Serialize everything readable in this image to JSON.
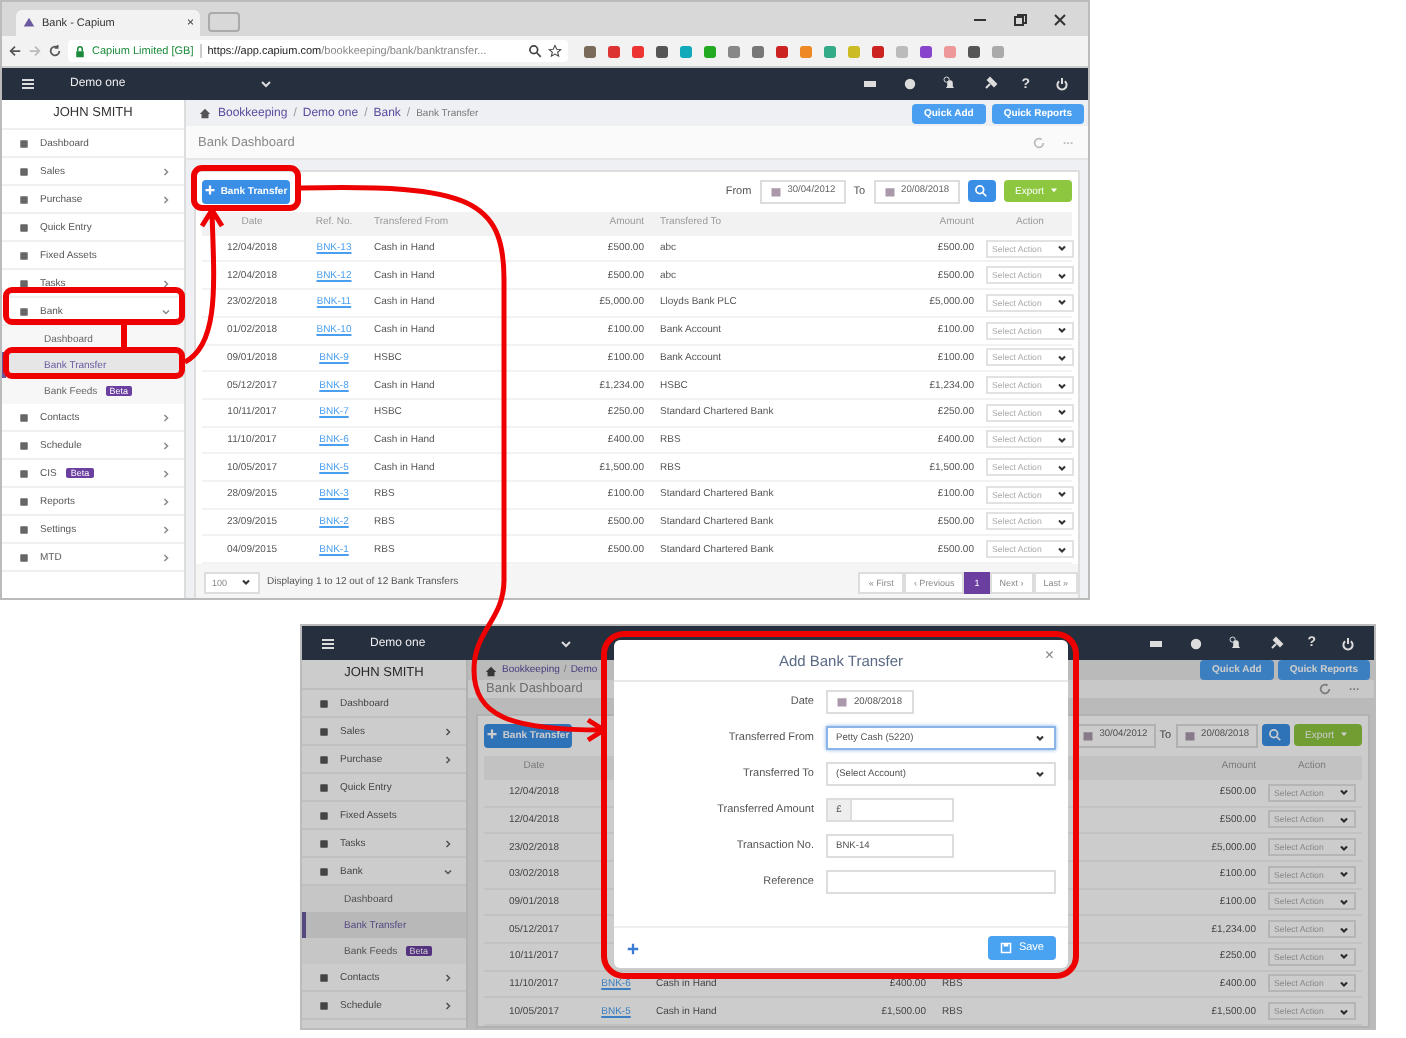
{
  "browser": {
    "tab_title": "Bank - Capium",
    "tab_close": "×",
    "site_name": "Capium Limited [GB]",
    "url_host": "https://app.capium.com",
    "url_path": "/bookkeeping/bank/banktransfer..."
  },
  "top": {
    "company": "Demo one",
    "help": "?",
    "user": "JOHN SMITH",
    "sidebar": [
      {
        "label": "Dashboard",
        "submenu": false
      },
      {
        "label": "Sales",
        "submenu": true,
        "expanded": false
      },
      {
        "label": "Purchase",
        "submenu": true,
        "expanded": false
      },
      {
        "label": "Quick Entry",
        "submenu": false
      },
      {
        "label": "Fixed Assets",
        "submenu": false
      },
      {
        "label": "Tasks",
        "submenu": true,
        "expanded": false
      },
      {
        "label": "Bank",
        "submenu": true,
        "expanded": true,
        "children": [
          {
            "label": "Dashboard",
            "selected": false
          },
          {
            "label": "Bank Transfer",
            "selected": true
          },
          {
            "label": "Bank Feeds",
            "selected": false,
            "badge": "Beta"
          }
        ]
      },
      {
        "label": "Contacts",
        "submenu": true,
        "expanded": false
      },
      {
        "label": "Schedule",
        "submenu": true,
        "expanded": false
      },
      {
        "label": "CIS",
        "submenu": true,
        "expanded": false,
        "badge": "Beta"
      },
      {
        "label": "Reports",
        "submenu": true,
        "expanded": false
      },
      {
        "label": "Settings",
        "submenu": true,
        "expanded": false
      },
      {
        "label": "MTD",
        "submenu": true,
        "expanded": false
      }
    ],
    "breadcrumb": [
      {
        "label": "Bookkeeping"
      },
      {
        "sep": "/",
        "label": "Demo one"
      },
      {
        "sep": "/",
        "label": "Bank"
      },
      {
        "sep": "/",
        "label": "Bank Transfer"
      }
    ],
    "quick_add": "Quick Add",
    "quick_reports": "Quick Reports",
    "page_title": "Bank Dashboard",
    "add_button": "Bank Transfer",
    "from_label": "From",
    "from_date": "30/04/2012",
    "to_label": "To",
    "to_date": "20/08/2018",
    "export": "Export",
    "columns": [
      "Date",
      "Ref. No.",
      "Transfered From",
      "Amount",
      "Transfered To",
      "Amount",
      "Action"
    ],
    "rows": [
      {
        "date": "12/04/2018",
        "ref": "BNK-13",
        "from": "Cash in Hand",
        "amount": "£500.00",
        "to": "abc",
        "amount_to": "£500.00",
        "action": "Select Action"
      },
      {
        "date": "12/04/2018",
        "ref": "BNK-12",
        "from": "Cash in Hand",
        "amount": "£500.00",
        "to": "abc",
        "amount_to": "£500.00",
        "action": "Select Action"
      },
      {
        "date": "23/02/2018",
        "ref": "BNK-11",
        "from": "Cash in Hand",
        "amount": "£5,000.00",
        "to": "Lloyds Bank PLC",
        "amount_to": "£5,000.00",
        "action": "Select Action"
      },
      {
        "date": "01/02/2018",
        "ref": "BNK-10",
        "from": "Cash in Hand",
        "amount": "£100.00",
        "to": "Bank Account",
        "amount_to": "£100.00",
        "action": "Select Action"
      },
      {
        "date": "09/01/2018",
        "ref": "BNK-9",
        "from": "HSBC",
        "amount": "£100.00",
        "to": "Bank Account",
        "amount_to": "£100.00",
        "action": "Select Action"
      },
      {
        "date": "05/12/2017",
        "ref": "BNK-8",
        "from": "Cash in Hand",
        "amount": "£1,234.00",
        "to": "HSBC",
        "amount_to": "£1,234.00",
        "action": "Select Action"
      },
      {
        "date": "10/11/2017",
        "ref": "BNK-7",
        "from": "HSBC",
        "amount": "£250.00",
        "to": "Standard Chartered Bank",
        "amount_to": "£250.00",
        "action": "Select Action"
      },
      {
        "date": "11/10/2017",
        "ref": "BNK-6",
        "from": "Cash in Hand",
        "amount": "£400.00",
        "to": "RBS",
        "amount_to": "£400.00",
        "action": "Select Action"
      },
      {
        "date": "10/05/2017",
        "ref": "BNK-5",
        "from": "Cash in Hand",
        "amount": "£1,500.00",
        "to": "RBS",
        "amount_to": "£1,500.00",
        "action": "Select Action"
      },
      {
        "date": "28/09/2015",
        "ref": "BNK-3",
        "from": "RBS",
        "amount": "£100.00",
        "to": "Standard Chartered Bank",
        "amount_to": "£100.00",
        "action": "Select Action"
      },
      {
        "date": "23/09/2015",
        "ref": "BNK-2",
        "from": "RBS",
        "amount": "£500.00",
        "to": "Standard Chartered Bank",
        "amount_to": "£500.00",
        "action": "Select Action"
      },
      {
        "date": "04/09/2015",
        "ref": "BNK-1",
        "from": "RBS",
        "amount": "£500.00",
        "to": "Standard Chartered Bank",
        "amount_to": "£500.00",
        "action": "Select Action"
      }
    ],
    "page_size": "100",
    "summary": "Displaying 1 to 12 out of 12 Bank Transfers",
    "pages": [
      {
        "label": "« First",
        "selected": false
      },
      {
        "label": "‹ Previous",
        "selected": false
      },
      {
        "label": "1",
        "selected": true
      },
      {
        "label": "Next ›",
        "selected": false
      },
      {
        "label": "Last »",
        "selected": false
      }
    ]
  },
  "bottom": {
    "company": "Demo one",
    "help": "?",
    "user": "JOHN SMITH",
    "sidebar": [
      {
        "label": "Dashboard",
        "submenu": false
      },
      {
        "label": "Sales",
        "submenu": true,
        "expanded": false
      },
      {
        "label": "Purchase",
        "submenu": true,
        "expanded": false
      },
      {
        "label": "Quick Entry",
        "submenu": false
      },
      {
        "label": "Fixed Assets",
        "submenu": false
      },
      {
        "label": "Tasks",
        "submenu": true,
        "expanded": false
      },
      {
        "label": "Bank",
        "submenu": true,
        "expanded": true,
        "children": [
          {
            "label": "Dashboard",
            "selected": false
          },
          {
            "label": "Bank Transfer",
            "selected": true
          },
          {
            "label": "Bank Feeds",
            "selected": false,
            "badge": "Beta"
          }
        ]
      },
      {
        "label": "Contacts",
        "submenu": true,
        "expanded": false
      },
      {
        "label": "Schedule",
        "submenu": true,
        "expanded": false
      }
    ],
    "breadcrumb": [
      {
        "label": "Bookkeeping"
      },
      {
        "sep": "/",
        "label": "Demo"
      }
    ],
    "quick_add": "Quick Add",
    "quick_reports": "Quick Reports",
    "page_title": "Bank Dashboard",
    "add_button": "Bank Transfer",
    "from_date": "30/04/2012",
    "to_label": "To",
    "to_date": "20/08/2018",
    "export": "Export",
    "header": {
      "date": "Date",
      "amount_to": "Amount",
      "action": "Action"
    },
    "rows": [
      {
        "date": "12/04/2018",
        "amount_to": "£500.00",
        "action": "Select Action"
      },
      {
        "date": "12/04/2018",
        "amount_to": "£500.00",
        "action": "Select Action"
      },
      {
        "date": "23/02/2018",
        "amount_to": "£5,000.00",
        "action": "Select Action"
      },
      {
        "date": "03/02/2018",
        "amount_to": "£100.00",
        "action": "Select Action"
      },
      {
        "date": "09/01/2018",
        "amount_to": "£100.00",
        "action": "Select Action"
      },
      {
        "date": "05/12/2017",
        "amount_to": "£1,234.00",
        "action": "Select Action"
      },
      {
        "date": "10/11/2017",
        "amount_to": "£250.00",
        "action": "Select Action"
      },
      {
        "date": "11/10/2017",
        "ref": "BNK-6",
        "from": "Cash in Hand",
        "amount": "£400.00",
        "to": "RBS",
        "amount_to": "£400.00",
        "action": "Select Action"
      },
      {
        "date": "10/05/2017",
        "ref": "BNK-5",
        "from": "Cash in Hand",
        "amount": "£1,500.00",
        "to": "RBS",
        "amount_to": "£1,500.00",
        "action": "Select Action"
      }
    ],
    "dialog": {
      "title": "Add Bank Transfer",
      "close": "×",
      "save": "Save",
      "fields": [
        {
          "kind": "date",
          "label": "Date",
          "value": "20/08/2018",
          "focused": false
        },
        {
          "kind": "select",
          "label": "Transferred From",
          "value": "Petty Cash (5220)",
          "focused": true
        },
        {
          "kind": "select",
          "label": "Transferred To",
          "value": "(Select Account)",
          "focused": false
        },
        {
          "kind": "amount",
          "label": "Transferred Amount",
          "prefix": "£",
          "focused": false
        },
        {
          "kind": "text",
          "label": "Transaction No.",
          "value": "BNK-14",
          "focused": false
        },
        {
          "kind": "wide",
          "label": "Reference",
          "focused": false
        }
      ]
    }
  }
}
